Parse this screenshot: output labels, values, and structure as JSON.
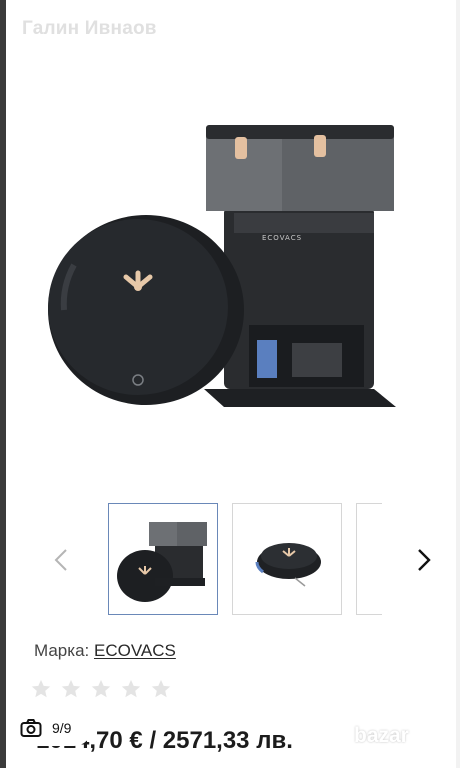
{
  "header": {
    "seller_name": "Галин Ивнаов"
  },
  "gallery": {
    "main_image_alt": "ECOVACS robot vacuum with station",
    "prev_icon": "chevron-left-icon",
    "next_icon": "chevron-right-icon",
    "thumbnails": [
      "robot-with-station",
      "robot-side-view",
      "partial-thumbnail"
    ],
    "counter": {
      "icon": "camera-icon",
      "text": "9/9"
    }
  },
  "product": {
    "brand_label": "Марка:",
    "brand_value": "ECOVACS",
    "rating_stars": 0,
    "rating_max": 5,
    "price": "1014,70 € / 2571,33 лв."
  },
  "watermark": {
    "text": "bazar"
  },
  "colors": {
    "accent": "#6a88b8",
    "text": "#1c1c1c",
    "star_empty": "#e4e4e4"
  }
}
